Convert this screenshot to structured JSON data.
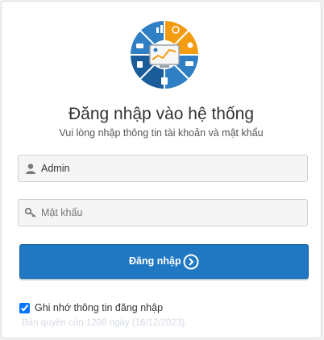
{
  "header": {
    "logo_icon": "analytics-dashboard-icon",
    "title": "Đăng nhập vào hệ thống",
    "subtitle": "Vui lòng nhập thông tin tài khoản và mật khẩu"
  },
  "form": {
    "username": {
      "value": "Admin",
      "placeholder": "",
      "icon": "user-icon"
    },
    "password": {
      "value": "",
      "placeholder": "Mật khẩu",
      "icon": "key-icon"
    },
    "login_button": {
      "label": "Đăng nhập",
      "icon": "arrow-circle-right-icon"
    },
    "remember": {
      "label": "Ghi nhớ thông tin đăng nhập",
      "checked": true
    }
  },
  "footer": {
    "copyright": "Bản quyền còn 1208 ngày (16/12/2023)."
  },
  "colors": {
    "primary": "#1f78c1",
    "logo_blue": "#2e7fc4",
    "logo_orange": "#f39c12",
    "logo_navy": "#1b5d9a"
  }
}
